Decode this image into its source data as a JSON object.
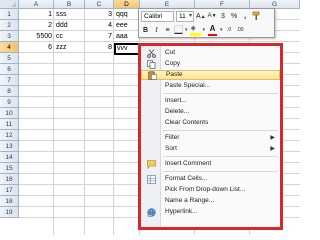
{
  "sheet": {
    "columns": [
      "A",
      "B",
      "C",
      "D",
      "E",
      "F",
      "G"
    ],
    "selected_column": "D",
    "rows": [
      "1",
      "2",
      "3",
      "4",
      "5",
      "6",
      "7",
      "8",
      "9",
      "10",
      "11",
      "12",
      "13",
      "14",
      "15",
      "16",
      "17",
      "18",
      "19"
    ],
    "selected_row": "4",
    "cells": {
      "a1": "1",
      "b1": "sss",
      "c1": "3",
      "d1": "qqq",
      "a2": "2",
      "b2": "ddd",
      "c2": "4",
      "d2": "eee",
      "a3": "5500",
      "b3": "cc",
      "c3": "7",
      "d3": "aaa",
      "a4": "6",
      "b4": "zzz",
      "c4": "8",
      "d4": "vvv"
    }
  },
  "mini_toolbar": {
    "font_name": "Calibri",
    "font_size": "11",
    "bold_label": "B",
    "italic_label": "I",
    "align_label": "≡",
    "fill_color": "#ffff00",
    "font_color": "#ff0000",
    "icons": [
      "grow-font-icon",
      "shrink-font-icon",
      "currency-icon",
      "percent-icon",
      "comma-style-icon",
      "format-painter-icon",
      "center-align-icon",
      "borders-icon",
      "fill-color-icon",
      "font-color-icon",
      "decrease-decimal-icon",
      "increase-decimal-icon"
    ]
  },
  "context_menu": {
    "items": [
      {
        "label": "Cut",
        "icon": "scissors-icon"
      },
      {
        "label": "Copy",
        "icon": "copy-icon"
      },
      {
        "label": "Paste",
        "icon": "paste-icon",
        "highlighted": true
      },
      {
        "label": "Paste Special...",
        "icon": ""
      },
      {
        "label": "Insert...",
        "icon": ""
      },
      {
        "label": "Delete...",
        "icon": ""
      },
      {
        "label": "Clear Contents",
        "icon": ""
      },
      {
        "label": "Filter",
        "icon": "",
        "submenu": true
      },
      {
        "label": "Sort",
        "icon": "",
        "submenu": true
      },
      {
        "label": "Insert Comment",
        "icon": "comment-icon"
      },
      {
        "label": "Format Cells...",
        "icon": "format-cells-icon"
      },
      {
        "label": "Pick From Drop-down List...",
        "icon": ""
      },
      {
        "label": "Name a Range...",
        "icon": ""
      },
      {
        "label": "Hyperlink...",
        "icon": "hyperlink-icon"
      }
    ],
    "highlight_color": "#fde494",
    "border_color": "#d8282d"
  }
}
